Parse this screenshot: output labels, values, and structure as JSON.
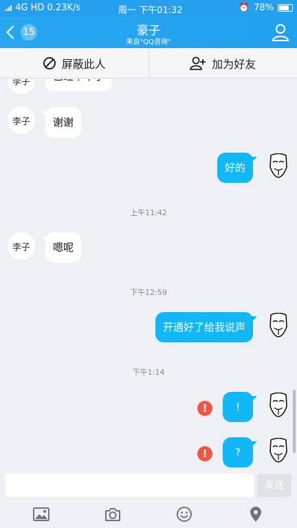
{
  "status_bar": {
    "left": "4G HD 0.23K/s",
    "center": "周一  下午01:32",
    "battery": "78%"
  },
  "nav": {
    "back_badge": "15",
    "title": "豪子",
    "subtitle": "来自\"QQ咨询\""
  },
  "actions": {
    "block_label": "屏蔽此人",
    "add_friend_label": "加为好友"
  },
  "messages": [
    {
      "side": "left",
      "text": "已经下单了"
    },
    {
      "side": "left",
      "text": "谢谢"
    },
    {
      "side": "right",
      "text": "好的"
    },
    {
      "timestamp": "上午11:42"
    },
    {
      "side": "left",
      "text": "嗯呢"
    },
    {
      "timestamp": "下午12:59"
    },
    {
      "side": "right",
      "text": "开通好了给我说声"
    },
    {
      "timestamp": "下午1:14"
    },
    {
      "side": "right",
      "text": "!",
      "failed": true
    },
    {
      "side": "right",
      "text": "?",
      "failed": true
    }
  ],
  "contact_avatar_text": "李子",
  "composer": {
    "placeholder": "",
    "send_label": "发送"
  },
  "toolbar": [
    "image-icon",
    "camera-icon",
    "emoji-icon",
    "location-icon"
  ],
  "colors": {
    "accent": "#21a2ee",
    "bubble_self": "#12b7f5",
    "error": "#f25643"
  }
}
